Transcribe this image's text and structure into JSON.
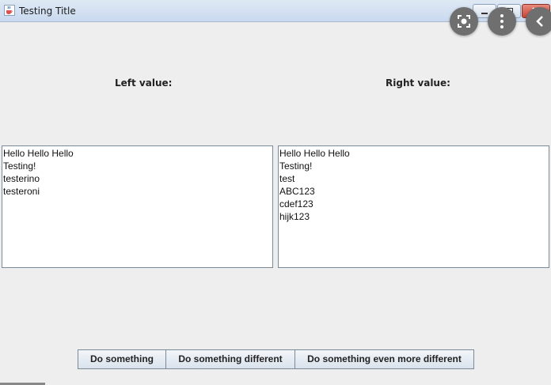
{
  "window": {
    "title": "Testing Title"
  },
  "labels": {
    "left": "Left value:",
    "right": "Right value:"
  },
  "left_text": [
    "Hello Hello Hello",
    "Testing!",
    "testerino",
    "testeroni"
  ],
  "right_text": [
    "Hello Hello Hello",
    "Testing!",
    "test",
    "ABC123",
    "cdef123",
    "hijk123"
  ],
  "buttons": {
    "b1": "Do something",
    "b2": "Do something different",
    "b3": "Do something even more different"
  },
  "icons": {
    "app": "java-cup-icon",
    "minimize": "minimize-icon",
    "maximize": "maximize-icon",
    "close": "close-icon",
    "overlay_1": "lens-icon",
    "overlay_2": "more-vertical-icon",
    "overlay_3": "chevron-left-icon"
  }
}
